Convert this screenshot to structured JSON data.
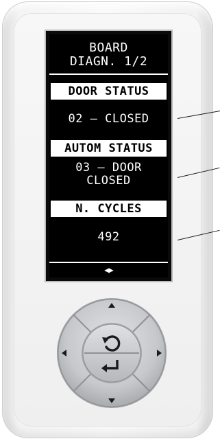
{
  "screen": {
    "title": "BOARD\nDIAGN. 1/2",
    "sections": [
      {
        "label": "DOOR STATUS",
        "value": "02 — CLOSED"
      },
      {
        "label": "AUTOM STATUS",
        "value": "03 — DOOR\nCLOSED"
      },
      {
        "label": "N. CYCLES",
        "value": "492"
      }
    ],
    "nav_indicator": "◀▶"
  },
  "keypad": {
    "up_icon": "caret-up-icon",
    "down_icon": "caret-down-icon",
    "left_icon": "caret-left-icon",
    "right_icon": "caret-right-icon",
    "back_icon": "rotate-ccw-icon",
    "enter_icon": "enter-return-icon"
  },
  "colors": {
    "screen_bg": "#000000",
    "screen_text": "#ffffff",
    "device_body": "#f4f4f4",
    "keypad_gray": "#c4c6c9"
  }
}
